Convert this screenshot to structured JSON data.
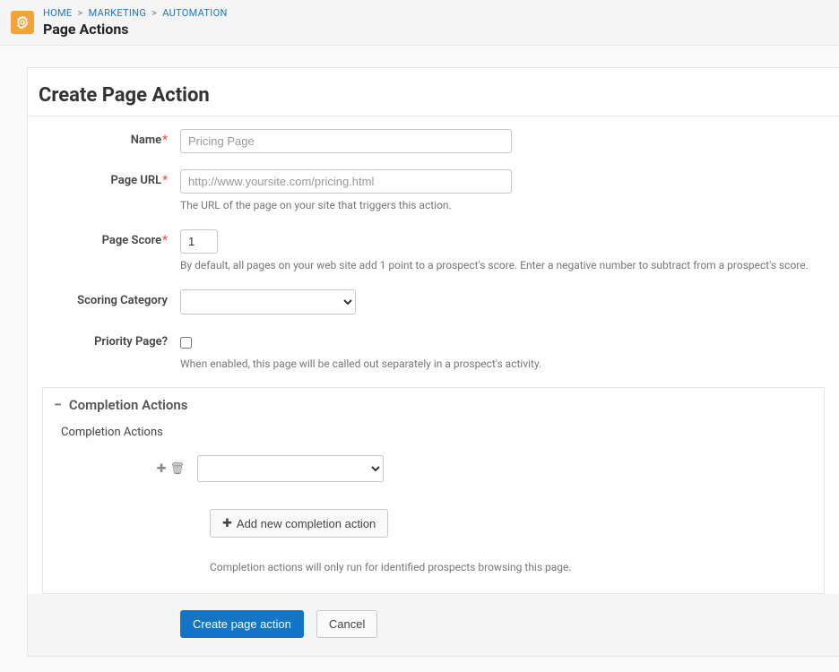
{
  "breadcrumb": {
    "items": [
      "HOME",
      "MARKETING",
      "AUTOMATION"
    ],
    "sep": ">"
  },
  "header": {
    "page_title": "Page Actions",
    "main_heading": "Create Page Action"
  },
  "form": {
    "name": {
      "label": "Name",
      "placeholder": "Pricing Page",
      "value": ""
    },
    "page_url": {
      "label": "Page URL",
      "placeholder": "http://www.yoursite.com/pricing.html",
      "value": "",
      "help": "The URL of the page on your site that triggers this action."
    },
    "page_score": {
      "label": "Page Score",
      "value": "1",
      "help": "By default, all pages on your web site add 1 point to a prospect's score. Enter a negative number to subtract from a prospect's score."
    },
    "scoring_category": {
      "label": "Scoring Category",
      "selected": ""
    },
    "priority_page": {
      "label": "Priority Page?",
      "checked": false,
      "help": "When enabled, this page will be called out separately in a prospect's activity."
    }
  },
  "completion_section": {
    "title": "Completion Actions",
    "sublabel": "Completion Actions",
    "add_button": "Add new completion action",
    "note": "Completion actions will only run for identified prospects browsing this page."
  },
  "footer": {
    "submit": "Create page action",
    "cancel": "Cancel"
  }
}
